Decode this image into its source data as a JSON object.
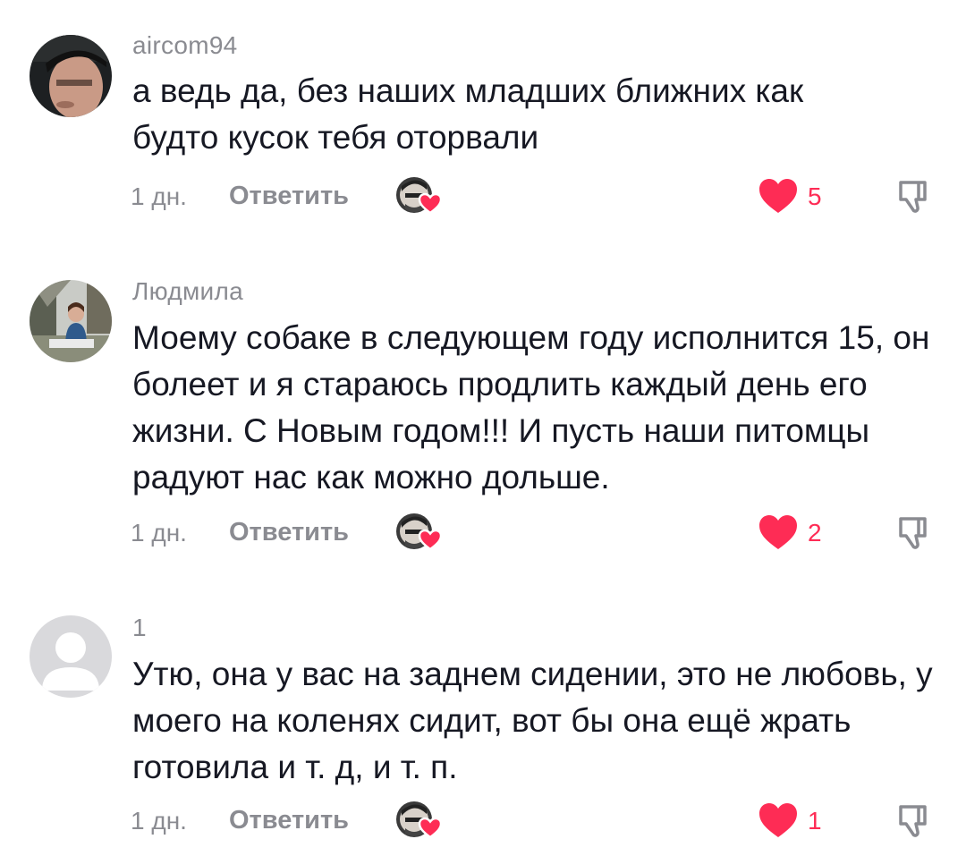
{
  "comments": [
    {
      "username": "aircom94",
      "text": "а ведь да, без наших младших ближних как будто кусок тебя оторвали",
      "time": "1 дн.",
      "reply_label": "Ответить",
      "likes": "5",
      "avatar_icon": "user-photo-avatar"
    },
    {
      "username": "Людмила",
      "text": "Моему собаке в следующем году исполнится 15, он болеет и я стараюсь продлить каждый день его жизни. С Новым годом!!! И пусть наши питомцы радуют нас как можно дольше.",
      "time": "1 дн.",
      "reply_label": "Ответить",
      "likes": "2",
      "avatar_icon": "user-photo-avatar"
    },
    {
      "username": "1",
      "text": "Утю, она у вас на заднем сидении, это не любовь, у моего на коленях сидит, вот бы она ещё жрать готовила и т. д, и т. п.",
      "time": "1 дн.",
      "reply_label": "Ответить",
      "likes": "1",
      "avatar_icon": "default-avatar-icon"
    }
  ],
  "colors": {
    "accent_like": "#fe2c55",
    "secondary_text": "#8a8b91",
    "primary_text": "#161823"
  }
}
